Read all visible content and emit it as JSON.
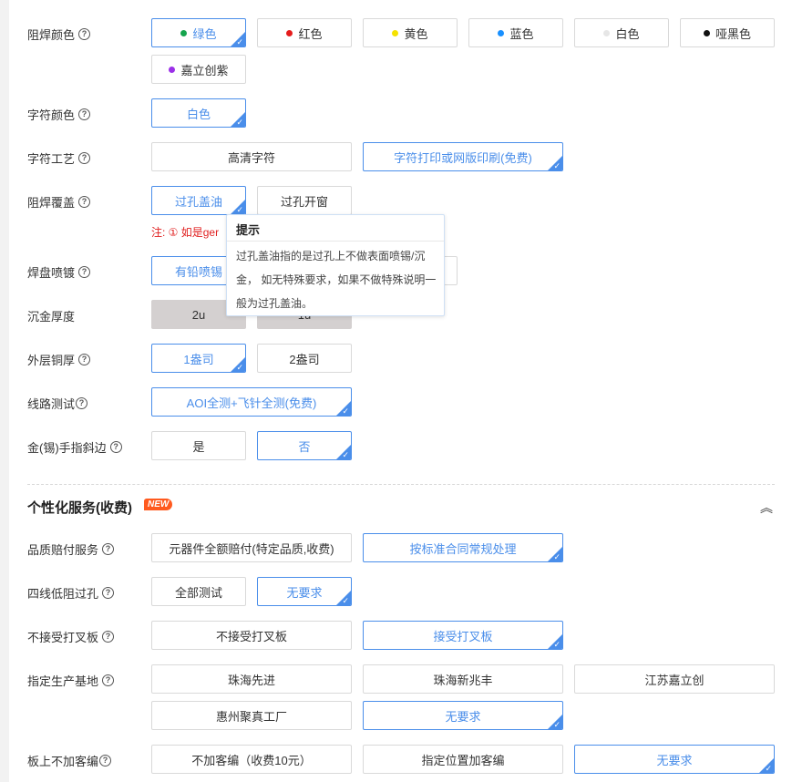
{
  "help_glyph": "?",
  "check_glyph": "✓",
  "rows": {
    "solder_color": {
      "label": "阻焊颜色",
      "options": [
        {
          "text": "绿色",
          "dot": "#14a44d",
          "selected": true
        },
        {
          "text": "红色",
          "dot": "#e51c1c"
        },
        {
          "text": "黄色",
          "dot": "#f5e200"
        },
        {
          "text": "蓝色",
          "dot": "#1890ff"
        },
        {
          "text": "白色",
          "dot": "#e6e6e6"
        },
        {
          "text": "哑黑色",
          "dot": "#111111"
        },
        {
          "text": "嘉立创紫",
          "dot": "#9b30e8"
        }
      ]
    },
    "char_color": {
      "label": "字符颜色",
      "options": [
        {
          "text": "白色",
          "selected": true
        }
      ]
    },
    "char_process": {
      "label": "字符工艺",
      "options": [
        {
          "text": "高清字符"
        },
        {
          "text": "字符打印或网版印刷(免费)",
          "selected": true
        }
      ]
    },
    "solder_cover": {
      "label": "阻焊覆盖",
      "options": [
        {
          "text": "过孔盖油",
          "selected": true
        },
        {
          "text": "过孔开窗"
        }
      ],
      "note": "注: ① 如是ger"
    },
    "pad_finish": {
      "label": "焊盘喷镀",
      "options": [
        {
          "text": "有铅喷锡"
        }
      ]
    },
    "gold_thickness": {
      "label": "沉金厚度",
      "options": [
        {
          "text": "2u"
        },
        {
          "text": "1u"
        }
      ]
    },
    "outer_copper": {
      "label": "外层铜厚",
      "options": [
        {
          "text": "1盎司",
          "selected": true
        },
        {
          "text": "2盎司"
        }
      ]
    },
    "circuit_test": {
      "label": "线路测试",
      "options": [
        {
          "text": "AOI全测+飞针全测(免费)",
          "selected": true
        }
      ]
    },
    "gold_finger": {
      "label": "金(锡)手指斜边",
      "options": [
        {
          "text": "是"
        },
        {
          "text": "否",
          "selected": true
        }
      ]
    }
  },
  "personal_service": {
    "title": "个性化服务(收费)",
    "badge": "NEW",
    "collapse_icon": "︽"
  },
  "service_rows": {
    "quality": {
      "label": "品质赔付服务",
      "options": [
        {
          "text": "元器件全额赔付(特定品质,收费)"
        },
        {
          "text": "按标准合同常规处理",
          "selected": true
        }
      ]
    },
    "four_wire": {
      "label": "四线低阻过孔",
      "options": [
        {
          "text": "全部测试"
        },
        {
          "text": "无要求",
          "selected": true
        }
      ]
    },
    "x_board": {
      "label": "不接受打叉板",
      "options": [
        {
          "text": "不接受打叉板"
        },
        {
          "text": "接受打叉板",
          "selected": true
        }
      ]
    },
    "factory": {
      "label": "指定生产基地",
      "options": [
        {
          "text": "珠海先进"
        },
        {
          "text": "珠海新兆丰"
        },
        {
          "text": "江苏嘉立创"
        },
        {
          "text": "惠州聚真工厂"
        },
        {
          "text": "无要求",
          "selected": true
        }
      ]
    },
    "customer_code": {
      "label": "板上不加客编",
      "options": [
        {
          "text": "不加客编（收费10元）"
        },
        {
          "text": "指定位置加客编"
        },
        {
          "text": "无要求",
          "selected": true
        }
      ]
    }
  },
  "tooltip": {
    "title": "提示",
    "body": "过孔盖油指的是过孔上不做表面喷锡/沉金， 如无特殊要求，如果不做特殊说明一般为过孔盖油。"
  }
}
